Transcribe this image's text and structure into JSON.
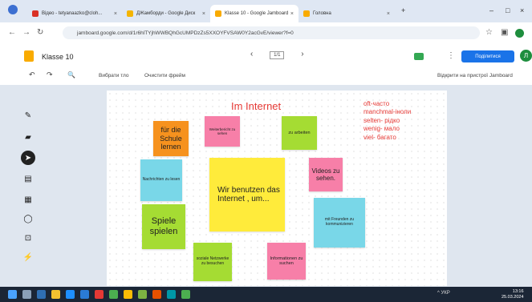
{
  "browser": {
    "tabs": [
      {
        "label": "Відео - tetyanaazko@cloh...",
        "fav_color": "#d93025"
      },
      {
        "label": "ДЖамборди - Google Диск",
        "fav_color": "#f4b400"
      },
      {
        "label": "Klasse 10 - Google Jamboard",
        "fav_color": "#f9ab00"
      },
      {
        "label": "Головна",
        "fav_color": "#f9ab00"
      }
    ],
    "new_tab": "+",
    "url": "jamboard.google.com/d/1r6hlTYjhWWBQhGcUMPDzZs5XXOYFVSAW0Y2acGvE/viewer?f=0"
  },
  "app": {
    "title": "Klasse 10",
    "page_indicator": "1/1",
    "share_label": "Поділитися",
    "avatar_letter": "Л",
    "toolbar": {
      "undo": "↶",
      "redo": "↷",
      "zoom": "🔍",
      "choose_bg": "Вибрати тло",
      "clear_frame": "Очистити фрейм",
      "open_device": "Відкрити на пристрої Jamboard"
    }
  },
  "board": {
    "title": "Im Internet",
    "vocab": [
      "oft-часто",
      "manchmal-іноли",
      "selten- рідко",
      "wenig- мало",
      "viel- багато"
    ],
    "notes": [
      {
        "text": "für die Schule lernen",
        "color": "#f6921e"
      },
      {
        "text": "Weiterbericht zu sehen",
        "color": "#f77fa8"
      },
      {
        "text": "zu arbeiten",
        "color": "#a5dc33"
      },
      {
        "text": "Nachrichten zu lesen",
        "color": "#79d7e8"
      },
      {
        "text": "Wir benutzen das Internet , um...",
        "color": "#ffeb3b"
      },
      {
        "text": "Videos zu sehen.",
        "color": "#f77fa8"
      },
      {
        "text": "Spiele spielen",
        "color": "#a5dc33"
      },
      {
        "text": "mit Freunden zu kommunizieren",
        "color": "#79d7e8"
      },
      {
        "text": "soziale Netzwerke zu besuchen",
        "color": "#a5dc33"
      },
      {
        "text": "Informationen zu suchen",
        "color": "#f77fa8"
      }
    ]
  },
  "taskbar": {
    "lang": "УКР",
    "time": "13:16",
    "date": "25.03.2024"
  }
}
